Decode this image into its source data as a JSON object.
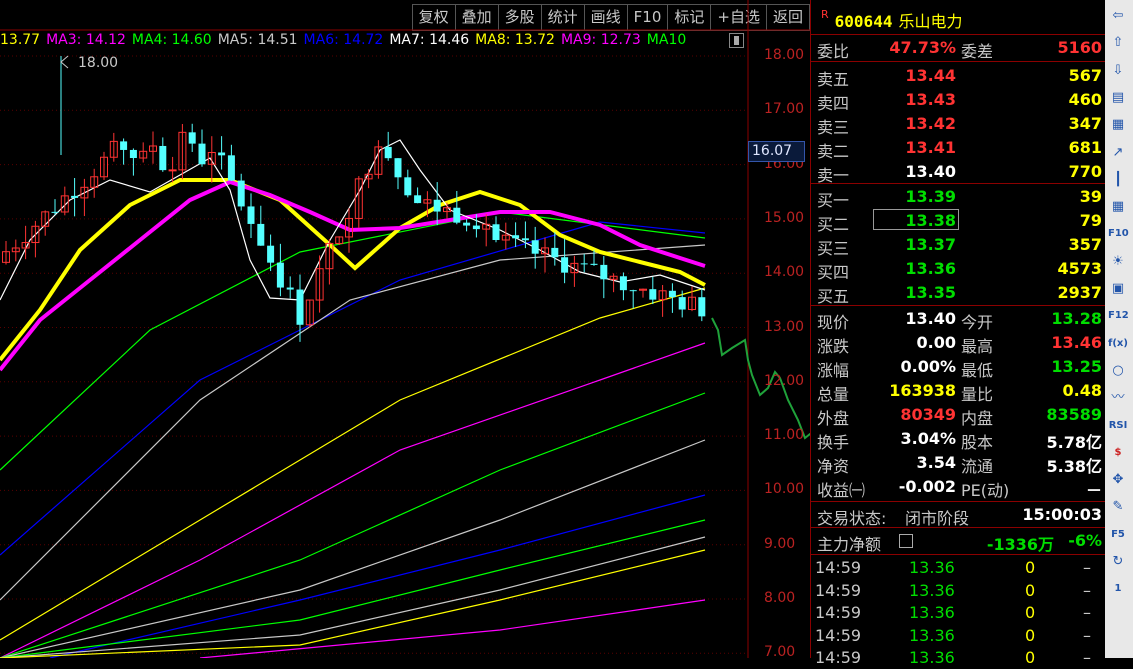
{
  "toolbar": [
    "复权",
    "叠加",
    "多股",
    "统计",
    "画线",
    "F10",
    "标记",
    "+自选",
    "返回"
  ],
  "ma": [
    {
      "label": "13.77",
      "color": "#ffff00"
    },
    {
      "label": "MA3: 14.12",
      "color": "#ff00ff"
    },
    {
      "label": "MA4: 14.60",
      "color": "#00ff00"
    },
    {
      "label": "MA5: 14.51",
      "color": "#c8c8c8"
    },
    {
      "label": "MA6: 14.72",
      "color": "#0000ff"
    },
    {
      "label": "MA7: 14.46",
      "color": "#ffffff"
    },
    {
      "label": "MA8: 13.72",
      "color": "#ffff00"
    },
    {
      "label": "MA9: 12.73",
      "color": "#ff00ff"
    },
    {
      "label": "MA10",
      "color": "#00ff00"
    }
  ],
  "axis": {
    "labels": [
      "18.00",
      "17.00",
      "16.00",
      "15.00",
      "14.00",
      "13.00",
      "12.00",
      "11.00",
      "10.00",
      "9.00",
      "8.00",
      "7.00"
    ],
    "min": 7.0,
    "max": 18.0
  },
  "high_marker": "18.00",
  "current_price": "16.07",
  "stock": {
    "r_mark": "R",
    "code": "600644",
    "name": "乐山电力"
  },
  "weibi": {
    "label": "委比",
    "value": "47.73%",
    "label2": "委差",
    "value2": "5160"
  },
  "sell": [
    {
      "label": "卖五",
      "price": "13.44",
      "vol": "567"
    },
    {
      "label": "卖四",
      "price": "13.43",
      "vol": "460"
    },
    {
      "label": "卖三",
      "price": "13.42",
      "vol": "347"
    },
    {
      "label": "卖二",
      "price": "13.41",
      "vol": "681"
    },
    {
      "label": "卖一",
      "price": "13.40",
      "vol": "770"
    }
  ],
  "buy": [
    {
      "label": "买一",
      "price": "13.39",
      "vol": "39"
    },
    {
      "label": "买二",
      "price": "13.38",
      "vol": "79"
    },
    {
      "label": "买三",
      "price": "13.37",
      "vol": "357"
    },
    {
      "label": "买四",
      "price": "13.36",
      "vol": "4573"
    },
    {
      "label": "买五",
      "price": "13.35",
      "vol": "2937"
    }
  ],
  "stats": [
    {
      "l1": "现价",
      "v1": "13.40",
      "c1": "wht",
      "l2": "今开",
      "v2": "13.28",
      "c2": "grn"
    },
    {
      "l1": "涨跌",
      "v1": "0.00",
      "c1": "wht",
      "l2": "最高",
      "v2": "13.46",
      "c2": "red"
    },
    {
      "l1": "涨幅",
      "v1": "0.00%",
      "c1": "wht",
      "l2": "最低",
      "v2": "13.25",
      "c2": "grn"
    },
    {
      "l1": "总量",
      "v1": "163938",
      "c1": "yel",
      "l2": "量比",
      "v2": "0.48",
      "c2": "yel"
    },
    {
      "l1": "外盘",
      "v1": "80349",
      "c1": "red",
      "l2": "内盘",
      "v2": "83589",
      "c2": "grn"
    },
    {
      "l1": "换手",
      "v1": "3.04%",
      "c1": "wht",
      "l2": "股本",
      "v2": "5.78亿",
      "c2": "wht"
    },
    {
      "l1": "净资",
      "v1": "3.54",
      "c1": "wht",
      "l2": "流通",
      "v2": "5.38亿",
      "c2": "wht"
    },
    {
      "l1": "收益㈠",
      "v1": "-0.002",
      "c1": "wht",
      "l2": "PE(动)",
      "v2": "－",
      "c2": "wht"
    }
  ],
  "status": {
    "label": "交易状态:",
    "value": "闭市阶段",
    "time": "15:00:03"
  },
  "mainflow": {
    "label": "主力净额",
    "value": "-1336万",
    "pct": "-6%"
  },
  "ticks": [
    {
      "t": "14:59",
      "p": "13.36",
      "q": "0",
      "d": "–"
    },
    {
      "t": "14:59",
      "p": "13.36",
      "q": "0",
      "d": "–"
    },
    {
      "t": "14:59",
      "p": "13.36",
      "q": "0",
      "d": "–"
    },
    {
      "t": "14:59",
      "p": "13.36",
      "q": "0",
      "d": "–"
    },
    {
      "t": "14:59",
      "p": "13.36",
      "q": "0",
      "d": "–"
    }
  ],
  "sidebar_icons": [
    "arrow-left",
    "arrow-up",
    "arrow-down",
    "f-report",
    "table",
    "trend",
    "candle",
    "grid",
    "f10",
    "bulb",
    "f-info",
    "f12",
    "fvx",
    "circle",
    "wave",
    "rsi",
    "s-dollar",
    "move",
    "pencil",
    "f5",
    "refresh",
    "1"
  ],
  "sidebar_labels": {
    "f10": "F10",
    "f12": "F12",
    "fvx": "f(x)",
    "rsi": "RSI",
    "s-dollar": "$",
    "f5": "F5",
    "1": "1"
  }
}
